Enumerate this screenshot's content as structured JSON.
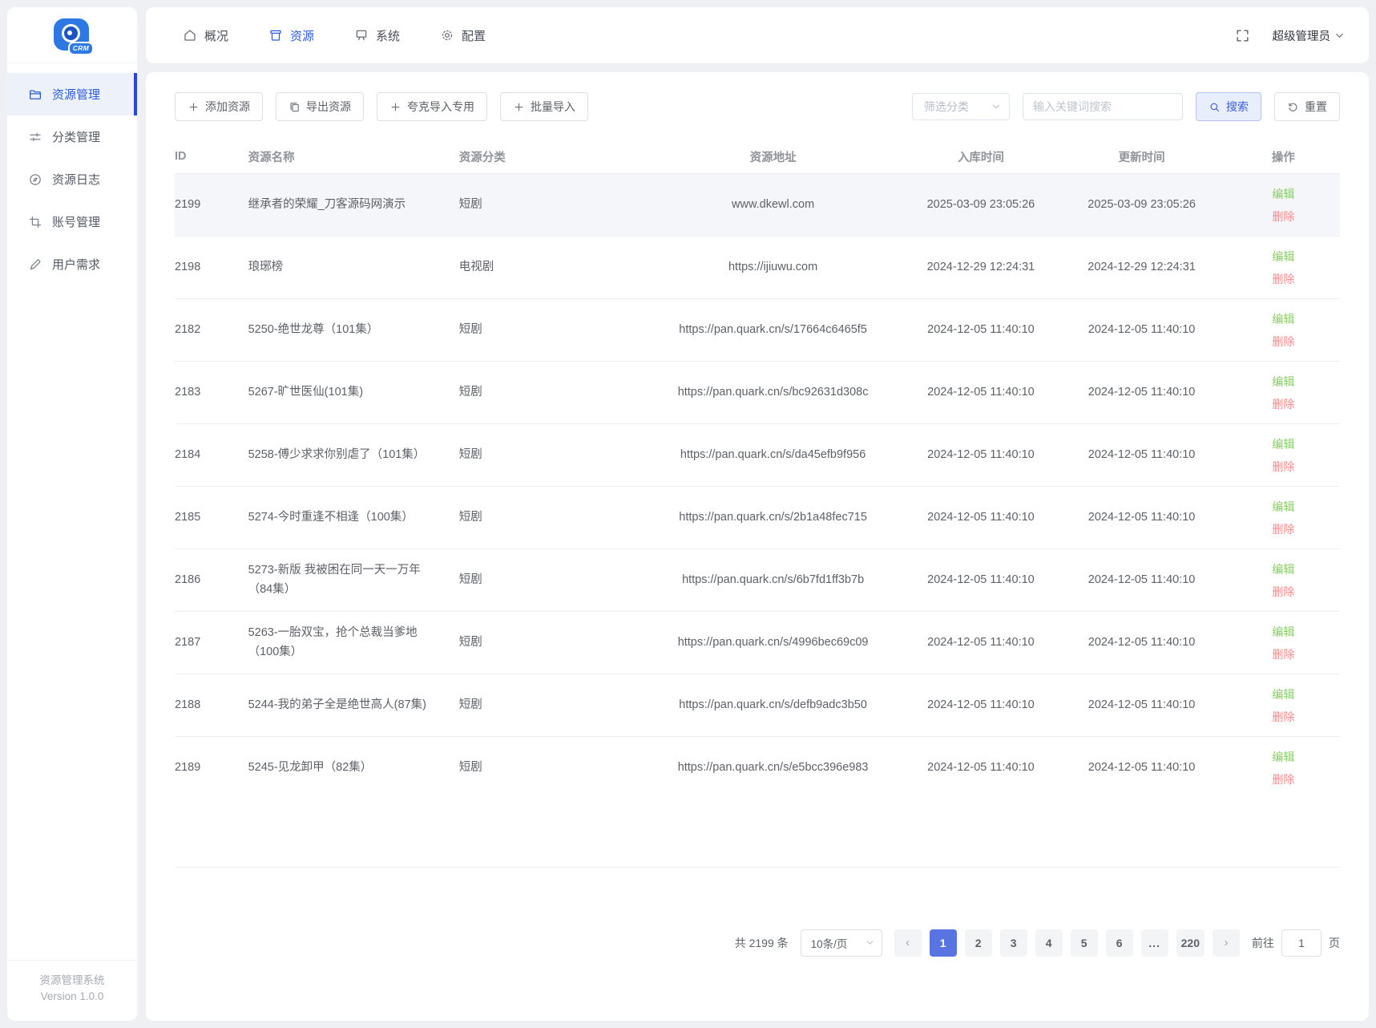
{
  "app": {
    "logo_text": "CRM",
    "footer_line1": "资源管理系统",
    "footer_line2": "Version 1.0.0"
  },
  "topnav": {
    "items": [
      {
        "label": "概况",
        "active": false
      },
      {
        "label": "资源",
        "active": true
      },
      {
        "label": "系统",
        "active": false
      },
      {
        "label": "配置",
        "active": false
      }
    ],
    "user_label": "超级管理员"
  },
  "sidebar": {
    "items": [
      {
        "label": "资源管理",
        "active": true
      },
      {
        "label": "分类管理",
        "active": false
      },
      {
        "label": "资源日志",
        "active": false
      },
      {
        "label": "账号管理",
        "active": false
      },
      {
        "label": "用户需求",
        "active": false
      }
    ]
  },
  "toolbar": {
    "add": "添加资源",
    "export": "导出资源",
    "quark_import": "夸克导入专用",
    "batch_import": "批量导入",
    "filter_placeholder": "筛选分类",
    "search_placeholder": "输入关键词搜索",
    "search": "搜索",
    "reset": "重置"
  },
  "table": {
    "columns": [
      "ID",
      "资源名称",
      "资源分类",
      "资源地址",
      "入库时间",
      "更新时间",
      "操作"
    ],
    "edit": "编辑",
    "delete": "删除",
    "rows": [
      {
        "id": "2199",
        "name": "继承者的荣耀_刀客源码网演示",
        "category": "短剧",
        "url": "www.dkewl.com",
        "created": "2025-03-09 23:05:26",
        "updated": "2025-03-09 23:05:26",
        "highlighted": true
      },
      {
        "id": "2198",
        "name": "琅琊榜",
        "category": "电视剧",
        "url": "https://ijiuwu.com",
        "created": "2024-12-29 12:24:31",
        "updated": "2024-12-29 12:24:31",
        "highlighted": false
      },
      {
        "id": "2182",
        "name": "5250-绝世龙尊（101集）",
        "category": "短剧",
        "url": "https://pan.quark.cn/s/17664c6465f5",
        "created": "2024-12-05 11:40:10",
        "updated": "2024-12-05 11:40:10",
        "highlighted": false
      },
      {
        "id": "2183",
        "name": "5267-旷世医仙(101集)",
        "category": "短剧",
        "url": "https://pan.quark.cn/s/bc92631d308c",
        "created": "2024-12-05 11:40:10",
        "updated": "2024-12-05 11:40:10",
        "highlighted": false
      },
      {
        "id": "2184",
        "name": "5258-傅少求求你别虐了（101集）",
        "category": "短剧",
        "url": "https://pan.quark.cn/s/da45efb9f956",
        "created": "2024-12-05 11:40:10",
        "updated": "2024-12-05 11:40:10",
        "highlighted": false
      },
      {
        "id": "2185",
        "name": "5274-今时重逢不相逢（100集）",
        "category": "短剧",
        "url": "https://pan.quark.cn/s/2b1a48fec715",
        "created": "2024-12-05 11:40:10",
        "updated": "2024-12-05 11:40:10",
        "highlighted": false
      },
      {
        "id": "2186",
        "name": "5273-新版 我被困在同一天一万年（84集）",
        "category": "短剧",
        "url": "https://pan.quark.cn/s/6b7fd1ff3b7b",
        "created": "2024-12-05 11:40:10",
        "updated": "2024-12-05 11:40:10",
        "highlighted": false
      },
      {
        "id": "2187",
        "name": "5263-一胎双宝，抢个总裁当爹地（100集）",
        "category": "短剧",
        "url": "https://pan.quark.cn/s/4996bec69c09",
        "created": "2024-12-05 11:40:10",
        "updated": "2024-12-05 11:40:10",
        "highlighted": false
      },
      {
        "id": "2188",
        "name": "5244-我的弟子全是绝世高人(87集)",
        "category": "短剧",
        "url": "https://pan.quark.cn/s/defb9adc3b50",
        "created": "2024-12-05 11:40:10",
        "updated": "2024-12-05 11:40:10",
        "highlighted": false
      },
      {
        "id": "2189",
        "name": "5245-见龙卸甲（82集）",
        "category": "短剧",
        "url": "https://pan.quark.cn/s/e5bcc396e983",
        "created": "2024-12-05 11:40:10",
        "updated": "2024-12-05 11:40:10",
        "highlighted": false
      }
    ]
  },
  "pagination": {
    "total": "共 2199 条",
    "page_size": "10条/页",
    "pages": [
      "1",
      "2",
      "3",
      "4",
      "5",
      "6",
      "...",
      "220"
    ],
    "active_page": "1",
    "goto_prefix": "前往",
    "goto_value": "1",
    "goto_suffix": "页"
  },
  "colors": {
    "primary_blue": "#2b5be0",
    "pager_active_blue": "#5873e2",
    "edit_green": "#85ce61",
    "delete_red": "#f78989"
  }
}
